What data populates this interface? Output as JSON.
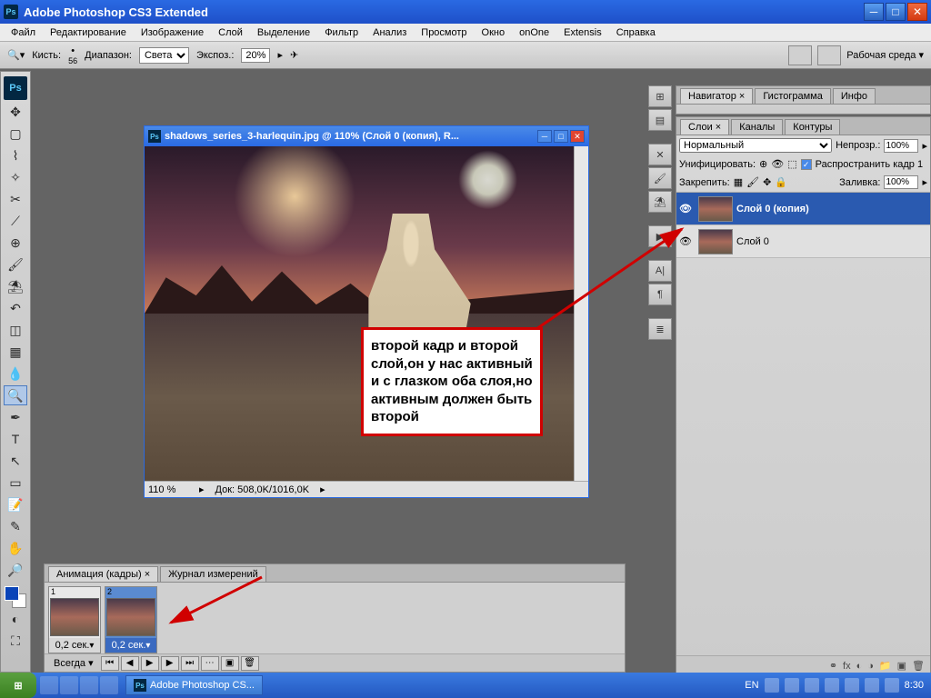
{
  "titlebar": {
    "app_icon": "Ps",
    "title": "Adobe Photoshop CS3 Extended"
  },
  "menu": [
    "Файл",
    "Редактирование",
    "Изображение",
    "Слой",
    "Выделение",
    "Фильтр",
    "Анализ",
    "Просмотр",
    "Окно",
    "onOne",
    "Extensis",
    "Справка"
  ],
  "options": {
    "brush_label": "Кисть:",
    "brush_value": "56",
    "range_label": "Диапазон:",
    "range_value": "Света",
    "exposure_label": "Экспоз.:",
    "exposure_value": "20%",
    "workspace": "Рабочая среда"
  },
  "document": {
    "title": "shadows_series_3-harlequin.jpg @ 110% (Слой 0 (копия), R...",
    "zoom": "110 %",
    "docinfo": "Док: 508,0K/1016,0K"
  },
  "annotation": "второй кадр и второй слой,он у нас активный и с глазком оба слоя,но активным должен быть второй",
  "nav_tabs": [
    "Навигатор",
    "Гистограмма",
    "Инфо"
  ],
  "layers_panel": {
    "tabs": [
      "Слои",
      "Каналы",
      "Контуры"
    ],
    "blend": "Нормальный",
    "opacity_label": "Непрозр.:",
    "opacity_value": "100%",
    "unify_label": "Унифицировать:",
    "propagate_label": "Распространить кадр 1",
    "lock_label": "Закрепить:",
    "fill_label": "Заливка:",
    "fill_value": "100%",
    "layers": [
      {
        "name": "Слой 0 (копия)",
        "active": true
      },
      {
        "name": "Слой 0",
        "active": false
      }
    ]
  },
  "animation": {
    "tabs": [
      "Анимация (кадры)",
      "Журнал измерений"
    ],
    "frames": [
      {
        "num": "1",
        "time": "0,2 сек.",
        "active": false
      },
      {
        "num": "2",
        "time": "0,2 сек.",
        "active": true
      }
    ],
    "loop": "Всегда"
  },
  "taskbar": {
    "active_task": "Adobe Photoshop CS...",
    "lang": "EN",
    "time": "8:30"
  }
}
